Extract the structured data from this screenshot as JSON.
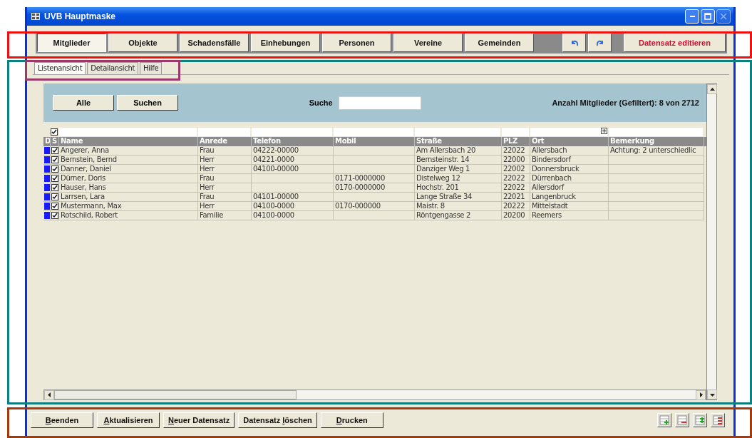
{
  "window": {
    "title": "UVB Hauptmaske"
  },
  "nav_buttons": [
    {
      "label": "Mitglieder",
      "selected": true
    },
    {
      "label": "Objekte",
      "selected": false
    },
    {
      "label": "Schadensfälle",
      "selected": false
    },
    {
      "label": "Einhebungen",
      "selected": false
    },
    {
      "label": "Personen",
      "selected": false
    },
    {
      "label": "Vereine",
      "selected": false
    },
    {
      "label": "Gemeinden",
      "selected": false
    }
  ],
  "edit_button": "Datensatz editieren",
  "view_tabs": [
    {
      "label": "Listenansicht",
      "selected": true
    },
    {
      "label": "Detailansicht",
      "selected": false
    },
    {
      "label": "Hilfe",
      "selected": false
    }
  ],
  "filter_buttons": [
    "Alle",
    "Suchen"
  ],
  "search": {
    "label": "Suche"
  },
  "count": "Anzahl Mitglieder (Gefiltert): 8 von 2712",
  "table": {
    "filter_checked": true,
    "marker_headers": [
      "D",
      "S"
    ],
    "columns": [
      "Name",
      "Anrede",
      "Telefon",
      "Mobil",
      "Straße",
      "PLZ",
      "Ort",
      "Bemerkung"
    ],
    "rows": [
      {
        "checked": true,
        "cells": [
          "Angerer, Anna",
          "Frau",
          "04222-00000",
          "",
          "Am Allersbach 20",
          "22022",
          "Allersbach",
          "Achtung: 2 unterschiedlic"
        ]
      },
      {
        "checked": true,
        "cells": [
          "Bernstein, Bernd",
          "Herr",
          "04221-0000",
          "",
          "Bernsteinstr. 14",
          "22000",
          "Bindersdorf",
          ""
        ]
      },
      {
        "checked": true,
        "cells": [
          "Danner, Daniel",
          "Herr",
          "04100-00000",
          "",
          "Danziger Weg 1",
          "22002",
          "Donnersbruck",
          ""
        ]
      },
      {
        "checked": true,
        "cells": [
          "Dürner, Doris",
          "Frau",
          "",
          "0171-0000000",
          "Distelweg 12",
          "22022",
          "Dürrenbach",
          ""
        ]
      },
      {
        "checked": true,
        "cells": [
          "Hauser, Hans",
          "Herr",
          "",
          "0170-0000000",
          "Hochstr. 201",
          "22022",
          "Allersdorf",
          ""
        ]
      },
      {
        "checked": true,
        "cells": [
          "Larrsen, Lara",
          "Frau",
          "04101-00000",
          "",
          "Lange Straße 34",
          "22021",
          "Langenbruck",
          ""
        ]
      },
      {
        "checked": true,
        "cells": [
          "Mustermann, Max",
          "Herr",
          "04100-0000",
          "0170-000000",
          "Maistr. 8",
          "20222",
          "Mittelstadt",
          ""
        ]
      },
      {
        "checked": true,
        "cells": [
          "Rotschild, Robert",
          "Familie",
          "04100-0000",
          "",
          "Röntgengasse 2",
          "20200",
          "Reemers",
          ""
        ]
      }
    ]
  },
  "bottom_buttons": [
    {
      "key": "B",
      "after": "eenden"
    },
    {
      "key": "A",
      "after": "ktualisieren"
    },
    {
      "key": "N",
      "after": "euer Datensatz"
    },
    {
      "before": "Datensatz ",
      "key": "l",
      "after": "öschen"
    },
    {
      "key": "D",
      "after": "rucken"
    }
  ]
}
